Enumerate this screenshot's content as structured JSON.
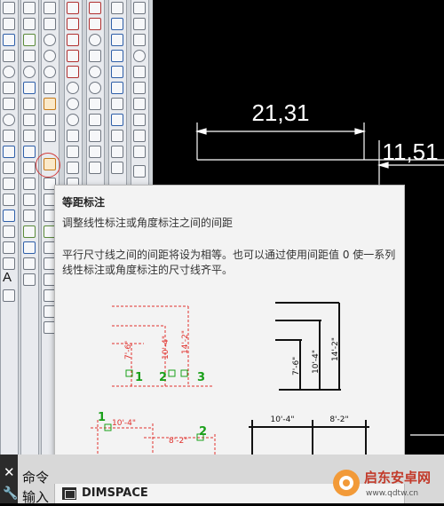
{
  "drawing": {
    "dim_1": "21,31",
    "dim_2": "11,51"
  },
  "tooltip": {
    "title": "等距标注",
    "subtitle": "调整线性标注或角度标注之间的间距",
    "description": "平行尺寸线之间的间距将设为相等。也可以通过使用间距值 0 使一系列线性标注或角度标注的尺寸线齐平。",
    "fig_left_dims": [
      "7'-6\"",
      "10'-4\"",
      "14'-2\""
    ],
    "fig_left_points": [
      "1",
      "2",
      "3"
    ],
    "fig_right_dims": [
      "7'-6\"",
      "10'-4\"",
      "14'-2\""
    ],
    "fig_bottom_left_dims": [
      "10'-4\"",
      "8'-2\""
    ],
    "fig_bottom_left_points": [
      "1",
      "2"
    ],
    "fig_bottom_right_dims": [
      "10'-4\"",
      "8'-2\""
    ],
    "command_name": "DIMSPACE"
  },
  "command_line": {
    "line1": "命令",
    "line2": "输入"
  },
  "watermark": {
    "name": "启东安卓网",
    "url": "www.qdtw.cn"
  },
  "toolbar": {
    "text_tool": "A"
  },
  "colors": {
    "canvas": "#000000",
    "red_dim": "#e0302c",
    "green_point": "#1aa01a",
    "highlight": "#d23c3c"
  }
}
